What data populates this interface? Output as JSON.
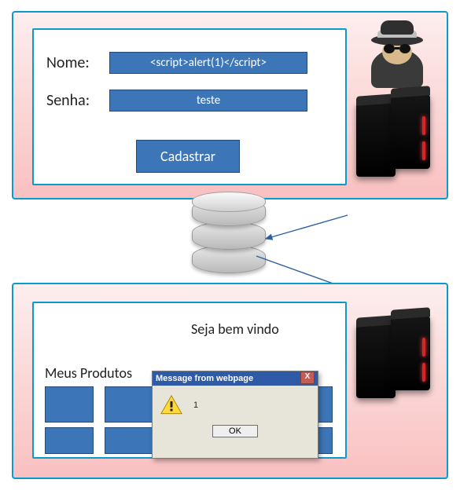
{
  "form": {
    "name_label": "Nome:",
    "name_value": "<script>alert(1)</script>",
    "password_label": "Senha:",
    "password_value": "teste",
    "submit_label": "Cadastrar"
  },
  "page2": {
    "welcome": "Seja bem vindo",
    "section_title": "Meus Produtos"
  },
  "alert": {
    "title": "Message from webpage",
    "message": "1",
    "ok_label": "OK",
    "close_label": "X"
  },
  "icons": {
    "hacker": "hacker-icon",
    "server": "server-icon",
    "database": "database-icon",
    "arrow": "arrow-icon",
    "warning": "warning-icon"
  }
}
